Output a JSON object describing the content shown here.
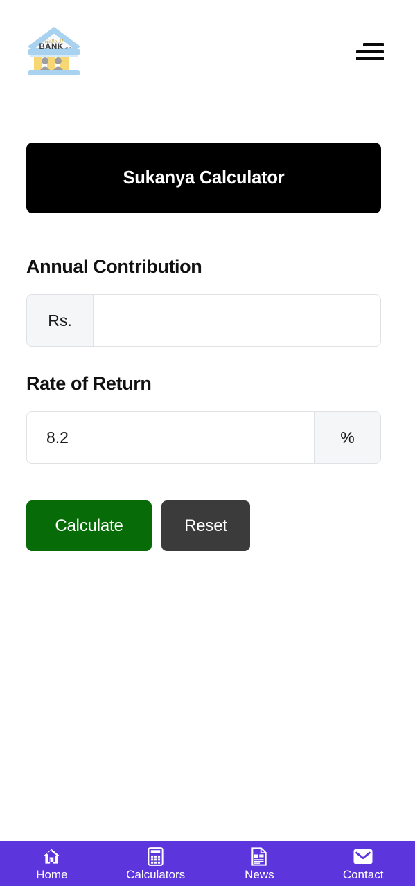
{
  "header": {
    "logo": {
      "icon": "bank-building-logo",
      "tagline": "Hello..!!",
      "wordmark": "BANK",
      "wordmark_suffix": "er"
    },
    "menu_icon": "hamburger-menu-icon"
  },
  "banner": {
    "title": "Sukanya Calculator",
    "background_color": "#000000",
    "text_color": "#ffffff"
  },
  "form": {
    "fields": [
      {
        "label": "Annual Contribution",
        "prefix": "Rs.",
        "suffix": "",
        "value": "",
        "placeholder": ""
      },
      {
        "label": "Rate of Return",
        "prefix": "",
        "suffix": "%",
        "value": "8.2",
        "placeholder": ""
      }
    ],
    "buttons": {
      "calculate": {
        "label": "Calculate",
        "color": "#076b07"
      },
      "reset": {
        "label": "Reset",
        "color": "#3b3b3b"
      }
    }
  },
  "bottom_nav": {
    "background_color": "#5d35dd",
    "items": [
      {
        "label": "Home",
        "icon": "home-icon"
      },
      {
        "label": "Calculators",
        "icon": "calculator-icon"
      },
      {
        "label": "News",
        "icon": "news-document-icon"
      },
      {
        "label": "Contact",
        "icon": "envelope-icon"
      }
    ]
  }
}
